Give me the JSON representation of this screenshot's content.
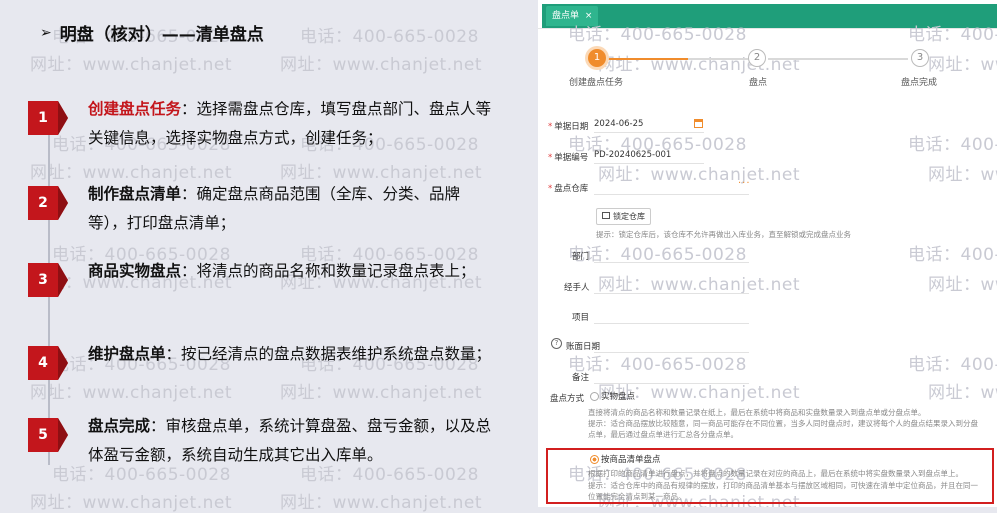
{
  "watermark": {
    "phone": "电话：400-665-0028",
    "site": "网址：www.chanjet.net"
  },
  "heading": {
    "arrow": "➢",
    "title": "明盘（核对）——清单盘点"
  },
  "steps": [
    {
      "num": "1",
      "title": "创建盘点任务",
      "desc": "：选择需盘点仓库，填写盘点部门、盘点人等关键信息，选择实物盘点方式，创建任务；"
    },
    {
      "num": "2",
      "title": "制作盘点清单",
      "desc": "：确定盘点商品范围（全库、分类、品牌等），打印盘点清单；"
    },
    {
      "num": "3",
      "title": "商品实物盘点",
      "desc": "：将清点的商品名称和数量记录盘点表上；"
    },
    {
      "num": "4",
      "title": "维护盘点单",
      "desc": "：按已经清点的盘点数据表维护系统盘点数量；"
    },
    {
      "num": "5",
      "title": "盘点完成",
      "desc": "：审核盘点单，系统计算盘盈、盘亏金额，以及总体盈亏金额，系统自动生成其它出入库单。"
    }
  ],
  "app": {
    "tab_label": "盘点单",
    "tab_close": "×",
    "wizard": [
      {
        "num": "1",
        "label": "创建盘点任务"
      },
      {
        "num": "2",
        "label": "盘点"
      },
      {
        "num": "3",
        "label": "盘点完成"
      }
    ],
    "fields": {
      "date_label": "单据日期",
      "date_value": "2024-06-25",
      "code_label": "单据编号",
      "code_value": "PD-20240625-001",
      "warehouse_label": "盘点仓库",
      "lock_button": "锁定仓库",
      "lock_hint": "提示：锁定仓库后，该仓库不允许再做出入库业务，直至解锁或完成盘点业务",
      "dept_label": "部门",
      "handler_label": "经手人",
      "project_label": "项目",
      "book_date_label": "账面日期",
      "remark_label": "备注",
      "method_label": "盘点方式"
    },
    "method_options": [
      {
        "label": "实物盘点",
        "selected": false,
        "desc1": "直接将清点的商品名称和数量记录在纸上，最后在系统中将商品和实盘数量录入到盘点单或分盘点单。",
        "desc2": "提示：适合商品摆放比较随意，同一商品可能存在不同位置，当多人同时盘点时，建议将每个人的盘点结果录入到分盘点单，最后通过盘点单进行汇总各分盘点单。"
      },
      {
        "label": "按商品清单盘点",
        "selected": true,
        "desc1": "根据打印的商品清单进行盘点，并将盘点的数量记录在对应的商品上，最后在系统中将实盘数量录入到盘点单上。",
        "desc2": "提示：适合仓库中的商品有规律的摆放，打印的商品清单基本与摆放区域相同，可快速在清单中定位商品，并且在同一位置能完全清点到某一商品。"
      }
    ]
  }
}
